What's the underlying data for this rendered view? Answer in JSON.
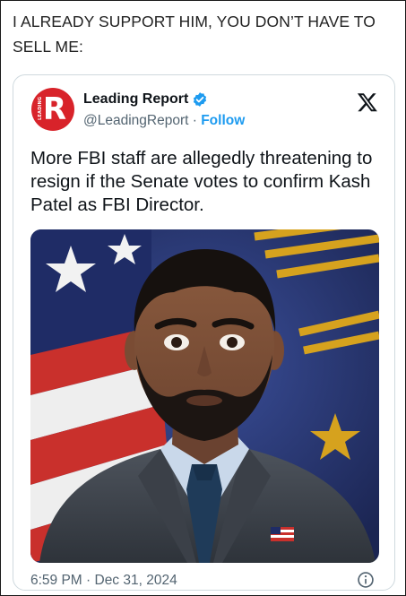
{
  "caption": "I ALREADY SUPPORT HIM, YOU DON’T HAVE TO SELL ME:",
  "tweet": {
    "author_name": "Leading Report",
    "handle": "@LeadingReport",
    "separator": " · ",
    "follow_label": "Follow",
    "avatar_letter": "R",
    "avatar_side_text": "LEADING",
    "text": "More FBI staff are allegedly threatening to resign if the Senate votes to confirm Kash Patel as FBI Director.",
    "timestamp": "6:59 PM · Dec 31, 2024"
  },
  "icons": {
    "verified": "verified-badge-icon",
    "platform": "x-logo-icon",
    "info": "info-icon"
  },
  "colors": {
    "avatar_bg": "#d8232a",
    "verified": "#1d9bf0",
    "follow": "#1d9bf0",
    "secondary_text": "#536471"
  }
}
